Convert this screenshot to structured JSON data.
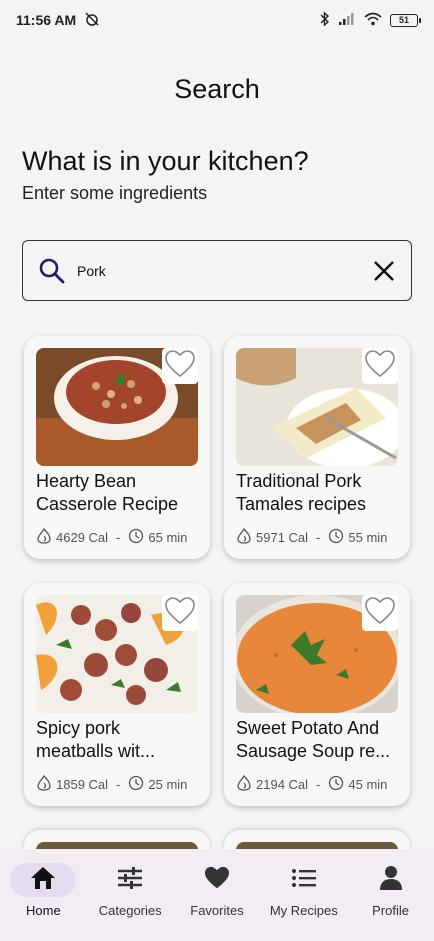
{
  "status_bar": {
    "time": "11:56 AM",
    "battery": "51",
    "icons": [
      "alarm-off-icon",
      "bluetooth-icon",
      "signal-icon",
      "wifi-icon",
      "battery-icon"
    ]
  },
  "header": {
    "title": "Search",
    "headline": "What is in your kitchen?",
    "subheadline": "Enter some ingredients"
  },
  "search": {
    "value": "Pork",
    "placeholder": ""
  },
  "recipes": [
    {
      "title": "Hearty Bean Casserole Recipe",
      "calories": "4629 Cal",
      "separator": "-",
      "time": "65 min"
    },
    {
      "title": "Traditional Pork Tamales recipes",
      "calories": "5971 Cal",
      "separator": "-",
      "time": "55 min"
    },
    {
      "title": "Spicy pork meatballs wit...",
      "calories": "1859 Cal",
      "separator": "-",
      "time": "25 min"
    },
    {
      "title": "Sweet Potato And Sausage Soup re...",
      "calories": "2194 Cal",
      "separator": "-",
      "time": "45 min"
    }
  ],
  "nav": {
    "items": [
      {
        "label": "Home",
        "icon": "home-icon",
        "active": true
      },
      {
        "label": "Categories",
        "icon": "sliders-icon",
        "active": false
      },
      {
        "label": "Favorites",
        "icon": "heart-icon",
        "active": false
      },
      {
        "label": "My Recipes",
        "icon": "list-icon",
        "active": false
      },
      {
        "label": "Profile",
        "icon": "person-icon",
        "active": false
      }
    ]
  },
  "colors": {
    "background": "#f4f4f4",
    "nav_background": "#f2ecf5",
    "nav_active_pill": "#e6dcef",
    "search_icon": "#2a1a6e"
  }
}
